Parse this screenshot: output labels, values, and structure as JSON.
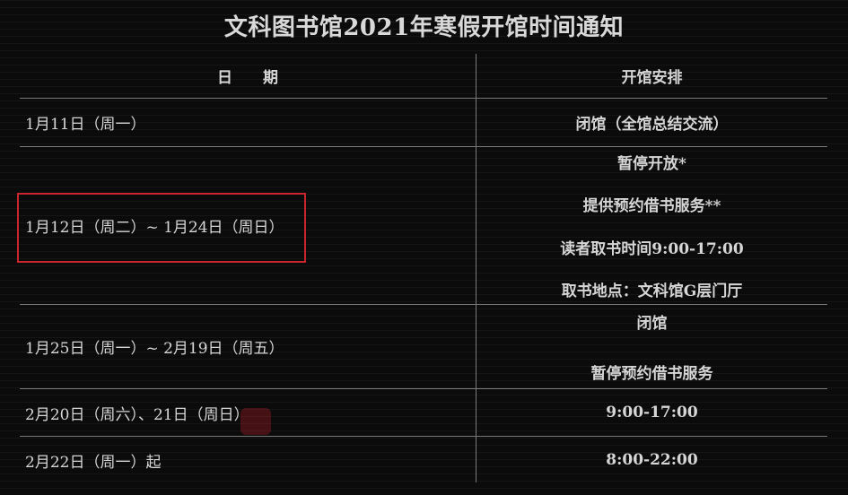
{
  "title": "文科图书馆2021年寒假开馆时间通知",
  "header": {
    "date": "日　　期",
    "arrangement": "开馆安排"
  },
  "rows": [
    {
      "date": "1月11日（周一）",
      "arrangement": [
        "闭馆（全馆总结交流）"
      ]
    },
    {
      "date": "1月12日（周二）~ 1月24日（周日）",
      "arrangement": [
        "暂停开放*",
        "提供预约借书服务**",
        "读者取书时间9:00-17:00",
        "取书地点：文科馆G层门厅"
      ]
    },
    {
      "date": "1月25日（周一）~ 2月19日（周五）",
      "arrangement": [
        "闭馆",
        "暂停预约借书服务"
      ]
    },
    {
      "date": "2月20日（周六）、21日（周日）",
      "arrangement": [
        "9:00-17:00"
      ]
    },
    {
      "date": "2月22日（周一）起",
      "arrangement": [
        "8:00-22:00"
      ]
    }
  ],
  "colors": {
    "background": "#0b0b0b",
    "text": "#d8d8d8",
    "highlight": "#c8252c"
  }
}
